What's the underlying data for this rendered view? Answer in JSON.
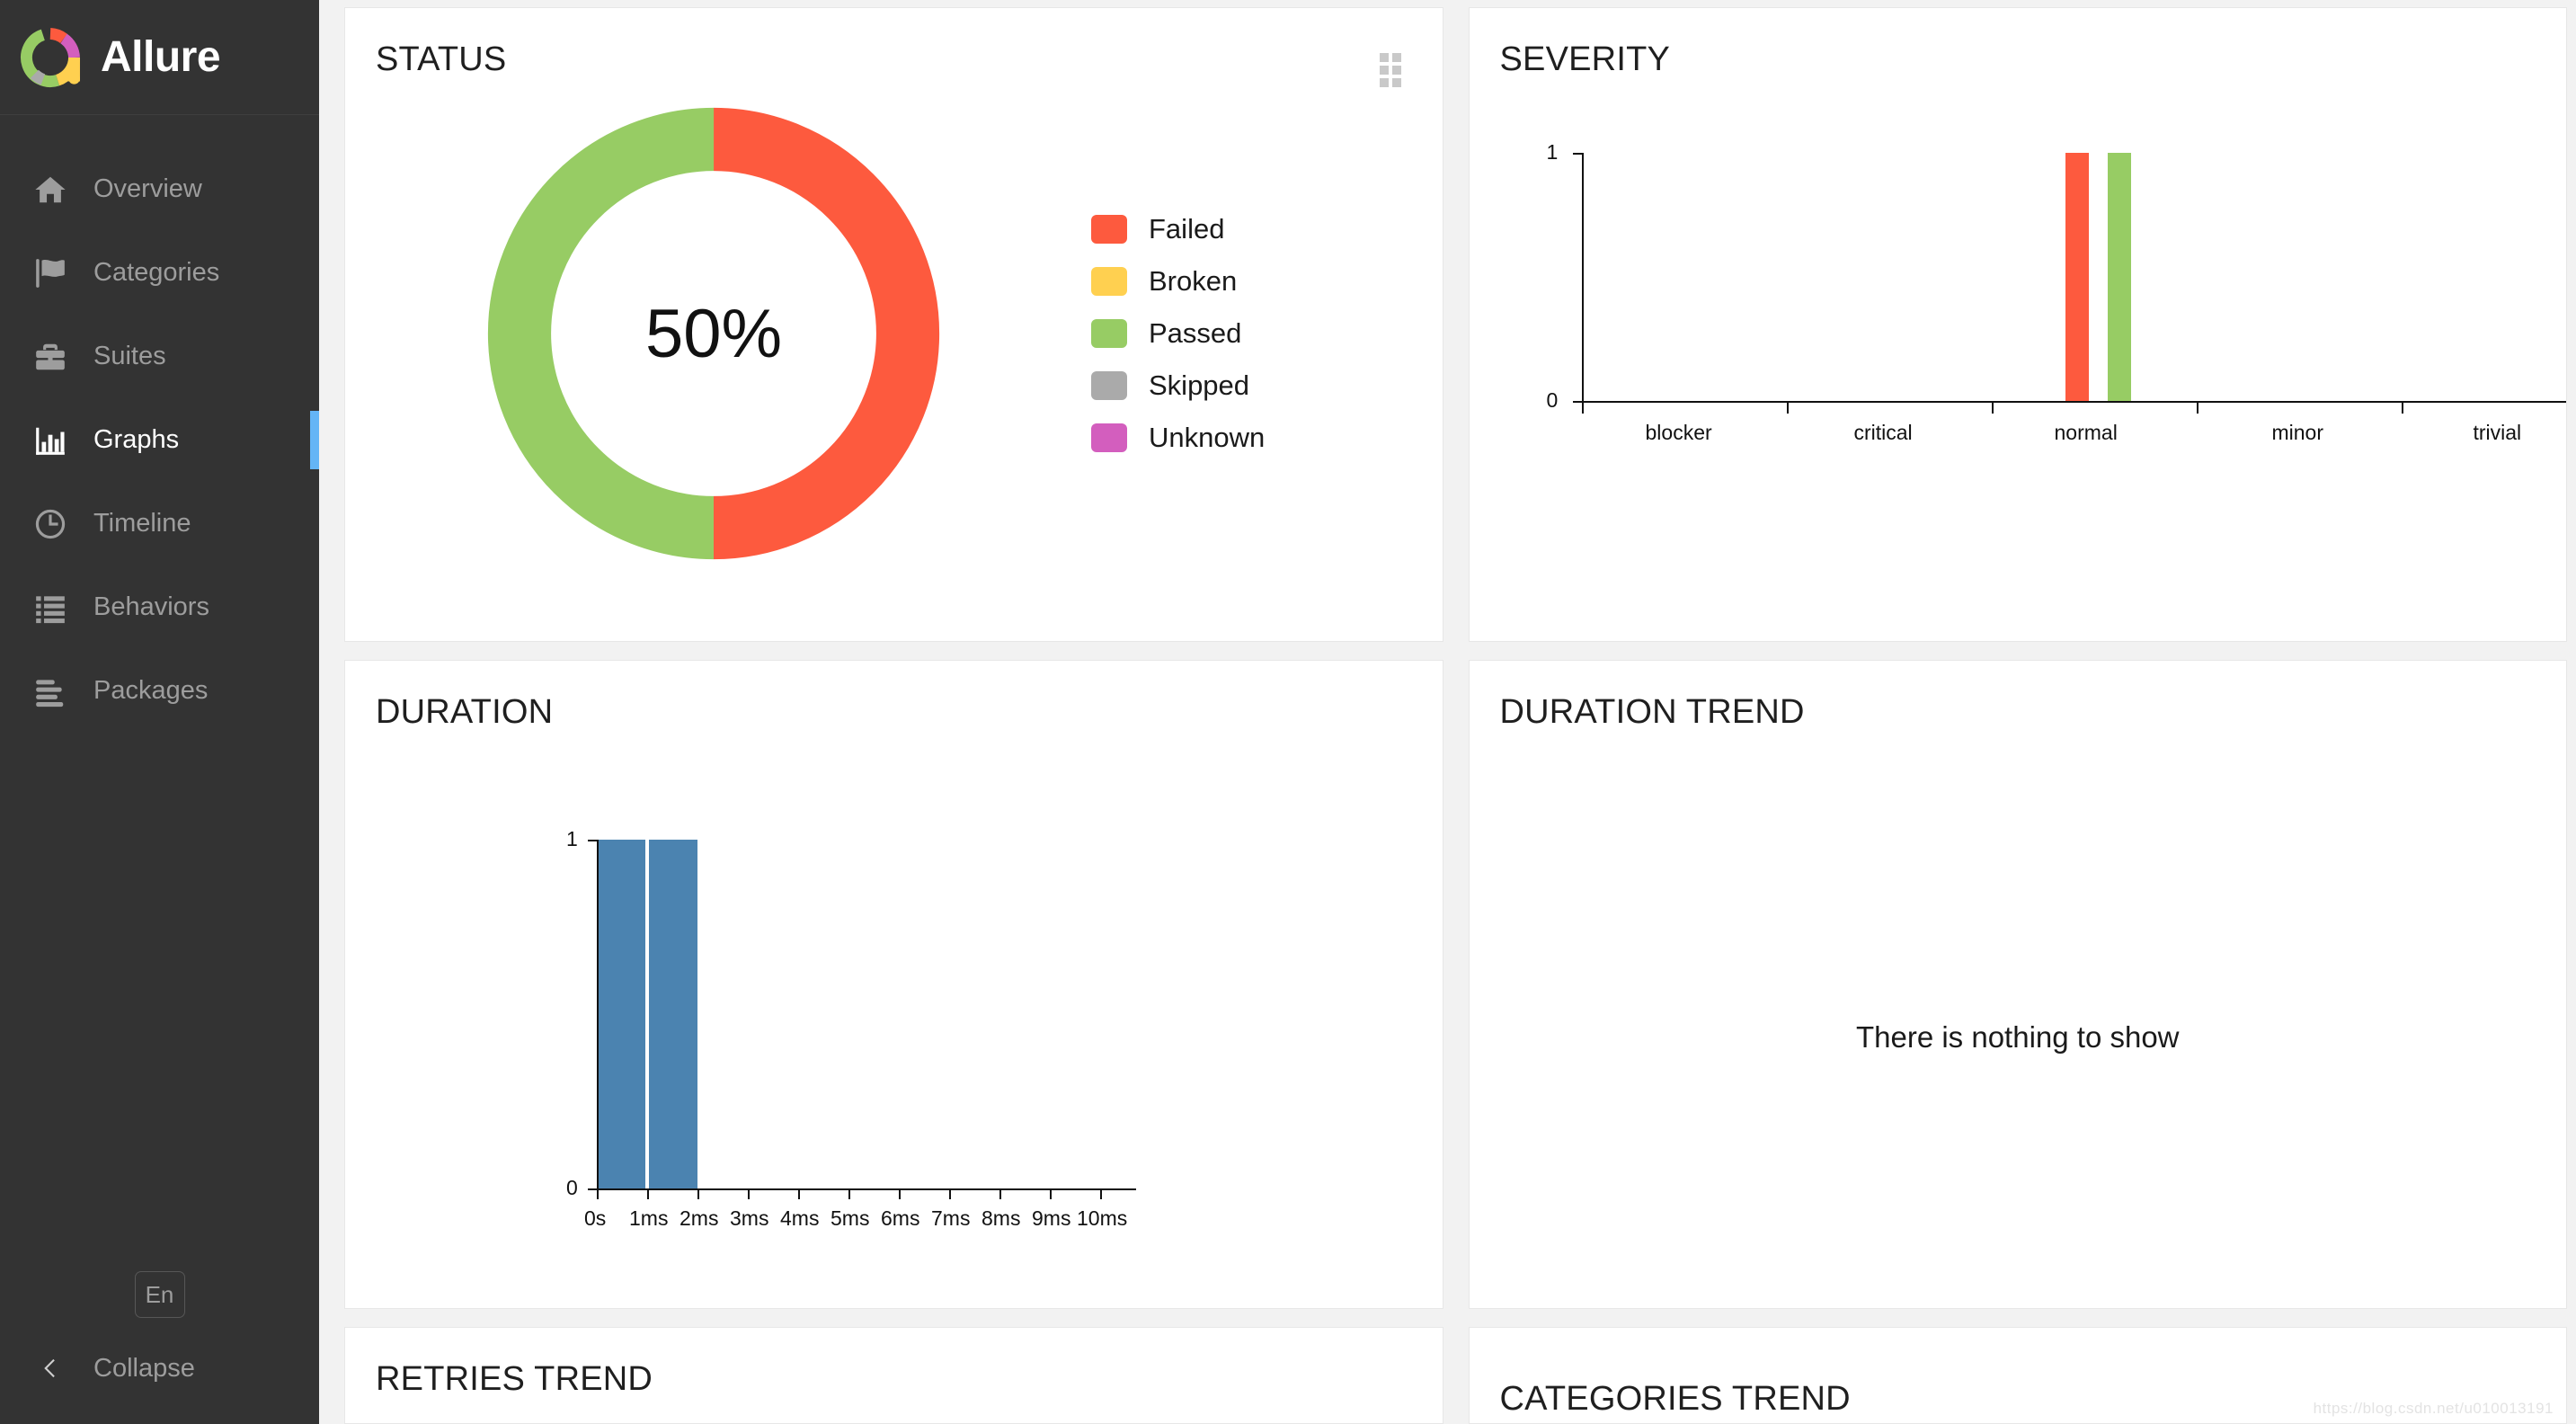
{
  "brand": {
    "name": "Allure",
    "logo_icon": "allure-donut-logo"
  },
  "sidebar": {
    "items": [
      {
        "label": "Overview",
        "icon": "home-icon",
        "active": false
      },
      {
        "label": "Categories",
        "icon": "flag-icon",
        "active": false
      },
      {
        "label": "Suites",
        "icon": "briefcase-icon",
        "active": false
      },
      {
        "label": "Graphs",
        "icon": "bar-chart-icon",
        "active": true
      },
      {
        "label": "Timeline",
        "icon": "clock-icon",
        "active": false
      },
      {
        "label": "Behaviors",
        "icon": "list-icon",
        "active": false
      },
      {
        "label": "Packages",
        "icon": "packages-icon",
        "active": false
      }
    ],
    "language_button": "En",
    "collapse_label": "Collapse",
    "collapse_icon": "chevron-left-icon",
    "accent_color": "#64b5f6"
  },
  "panels": {
    "status": {
      "title": "STATUS",
      "drag_handle_icon": "drag-handle-icon"
    },
    "severity": {
      "title": "SEVERITY"
    },
    "duration": {
      "title": "DURATION"
    },
    "duration_trend": {
      "title": "DURATION TREND",
      "empty_message": "There is nothing to show"
    },
    "retries_trend": {
      "title": "RETRIES TREND"
    },
    "categories_trend": {
      "title": "CATEGORIES TREND"
    }
  },
  "watermark": "https://blog.csdn.net/u010013191",
  "status_colors": {
    "failed": "#fd5a3e",
    "broken": "#ffd050",
    "passed": "#97cc64",
    "skipped": "#aaaaaa",
    "unknown": "#d35ebe",
    "duration_bar": "#4b83b0"
  },
  "chart_data": [
    {
      "id": "status",
      "type": "pie",
      "title": "STATUS",
      "center_label": "50%",
      "legend_position": "right",
      "labels": [
        "Failed",
        "Broken",
        "Passed",
        "Skipped",
        "Unknown"
      ],
      "values": [
        1,
        0,
        1,
        0,
        0
      ],
      "percentages": [
        50,
        0,
        50,
        0,
        0
      ],
      "colors": [
        "#fd5a3e",
        "#ffd050",
        "#97cc64",
        "#aaaaaa",
        "#d35ebe"
      ]
    },
    {
      "id": "severity",
      "type": "bar",
      "title": "SEVERITY",
      "xlabel": "",
      "ylabel": "",
      "categories": [
        "blocker",
        "critical",
        "normal",
        "minor",
        "trivial"
      ],
      "yticks": [
        "0",
        "1"
      ],
      "ylim": [
        0,
        1
      ],
      "grid": false,
      "series": [
        {
          "name": "Failed",
          "color": "#fd5a3e",
          "values": [
            0,
            0,
            1,
            0,
            0
          ]
        },
        {
          "name": "Passed",
          "color": "#97cc64",
          "values": [
            0,
            0,
            1,
            0,
            0
          ]
        }
      ]
    },
    {
      "id": "duration",
      "type": "bar",
      "title": "DURATION",
      "xlabel": "",
      "ylabel": "",
      "xticks": [
        "0s",
        "1ms",
        "2ms",
        "3ms",
        "4ms",
        "5ms",
        "6ms",
        "7ms",
        "8ms",
        "9ms",
        "10ms"
      ],
      "yticks": [
        "0",
        "1"
      ],
      "ylim": [
        0,
        1
      ],
      "grid": false,
      "bins": [
        "0s-1ms",
        "1ms-2ms",
        "2ms-3ms",
        "3ms-4ms",
        "4ms-5ms",
        "5ms-6ms",
        "6ms-7ms",
        "7ms-8ms",
        "8ms-9ms",
        "9ms-10ms"
      ],
      "values": [
        1,
        1,
        0,
        0,
        0,
        0,
        0,
        0,
        0,
        0
      ],
      "color": "#4b83b0"
    },
    {
      "id": "duration_trend",
      "type": "line",
      "title": "DURATION TREND",
      "series": [],
      "empty_message": "There is nothing to show"
    }
  ]
}
